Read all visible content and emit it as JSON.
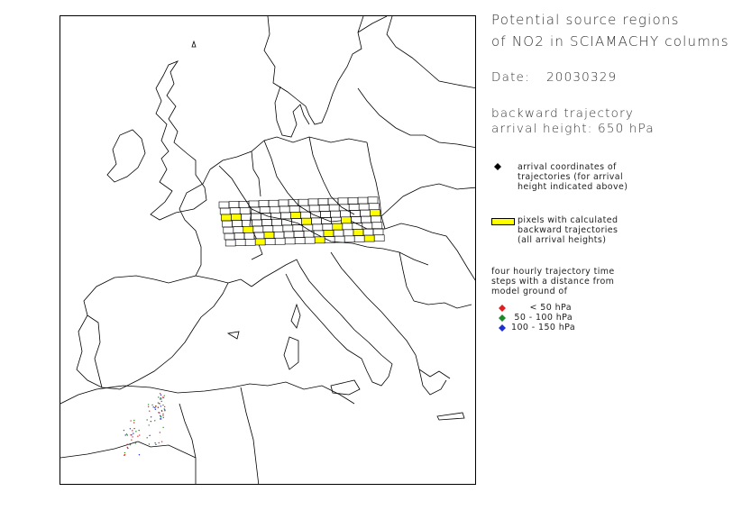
{
  "title": {
    "line1": "Potential source regions",
    "line2": "of NO2 in SCIAMACHY columns"
  },
  "date": {
    "label": "Date:",
    "value": "20030329"
  },
  "trajectory": {
    "line1": "backward trajectory",
    "line2": "arrival height: 650 hPa"
  },
  "legend": {
    "arrival": "arrival coordinates of\ntrajectories (for arrival\nheight indicated above)",
    "pixels": "pixels with calculated\nbackward trajectories\n(all arrival heights)",
    "steps_intro": "four hourly trajectory time\nsteps with a distance from\nmodel ground of",
    "ranges": [
      {
        "label": "      < 50 hPa",
        "color": "#e02020"
      },
      {
        "label": " 50 - 100 hPa",
        "color": "#1a8a2a"
      },
      {
        "label": "100 - 150 hPa",
        "color": "#2030d0"
      }
    ],
    "arrival_color": "#000000",
    "pixel_color": "#ffff00"
  }
}
